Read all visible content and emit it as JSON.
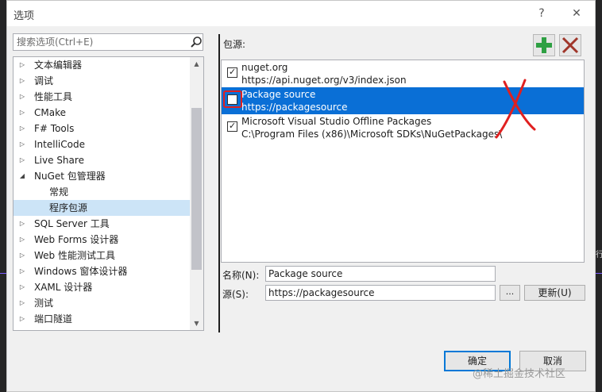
{
  "dialog": {
    "title": "选项",
    "help": "?",
    "close": "✕"
  },
  "search": {
    "placeholder": "搜索选项(Ctrl+E)"
  },
  "tree": {
    "items": [
      {
        "label": "文本编辑器",
        "arrow": "▷"
      },
      {
        "label": "调试",
        "arrow": "▷"
      },
      {
        "label": "性能工具",
        "arrow": "▷"
      },
      {
        "label": "CMake",
        "arrow": "▷"
      },
      {
        "label": "F# Tools",
        "arrow": "▷"
      },
      {
        "label": "IntelliCode",
        "arrow": "▷"
      },
      {
        "label": "Live Share",
        "arrow": "▷"
      },
      {
        "label": "NuGet 包管理器",
        "arrow": "◢"
      },
      {
        "label": "常规",
        "arrow": ""
      },
      {
        "label": "程序包源",
        "arrow": ""
      },
      {
        "label": "SQL Server 工具",
        "arrow": "▷"
      },
      {
        "label": "Web Forms 设计器",
        "arrow": "▷"
      },
      {
        "label": "Web 性能测试工具",
        "arrow": "▷"
      },
      {
        "label": "Windows 窗体设计器",
        "arrow": "▷"
      },
      {
        "label": "XAML 设计器",
        "arrow": "▷"
      },
      {
        "label": "测试",
        "arrow": "▷"
      },
      {
        "label": "端口隧道",
        "arrow": "▷"
      }
    ]
  },
  "sources": {
    "label": "包源:",
    "items": [
      {
        "name": "nuget.org",
        "url": "https://api.nuget.org/v3/index.json",
        "checked": true
      },
      {
        "name": "Package source",
        "url": "https://packagesource",
        "checked": false
      },
      {
        "name": "Microsoft Visual Studio Offline Packages",
        "url": "C:\\Program Files (x86)\\Microsoft SDKs\\NuGetPackages\\",
        "checked": true
      }
    ]
  },
  "form": {
    "name_label": "名称(N):",
    "name_value": "Package source",
    "source_label": "源(S):",
    "source_value": "https://packagesource",
    "browse": "...",
    "update": "更新(U)"
  },
  "buttons": {
    "ok": "确定",
    "cancel": "取消"
  },
  "watermark": "@稀土掘金技术社区",
  "edge_text": "行",
  "colors": {
    "selection": "#0a6fd6",
    "tree_selection": "#cce4f7",
    "add_green": "#2ea043",
    "remove_red": "#a0362a",
    "annotation_red": "#e02020"
  }
}
